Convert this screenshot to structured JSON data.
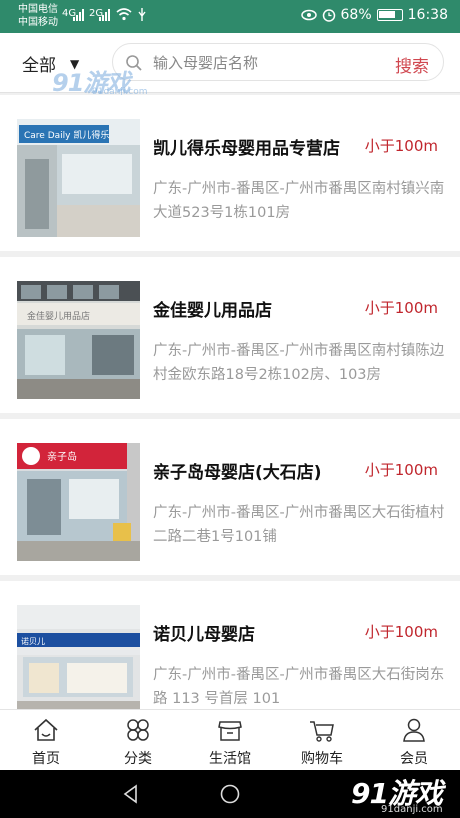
{
  "status_bar": {
    "carrier_1": "中国电信",
    "carrier_2": "中国移动",
    "net_1": "4G",
    "net_2": "2G",
    "battery": "68%",
    "time": "16:38"
  },
  "header": {
    "filter_label": "全部",
    "search_placeholder": "输入母婴店名称",
    "search_button": "搜索"
  },
  "watermark": {
    "logo": "91游戏",
    "url": "91danji.com"
  },
  "stores": [
    {
      "name": "凯儿得乐母婴用品专营店",
      "distance": "小于100m",
      "address": "广东-广州市-番禺区-广州市番禺区南村镇兴南大道523号1栋101房",
      "sign_text": "Care Daily  凯儿得乐"
    },
    {
      "name": "金佳婴儿用品店",
      "distance": "小于100m",
      "address": "广东-广州市-番禺区-广州市番禺区南村镇陈边村金欧东路18号2栋102房、103房",
      "sign_text": "金佳婴儿用品店"
    },
    {
      "name": "亲子岛母婴店(大石店)",
      "distance": "小于100m",
      "address": "广东-广州市-番禺区-广州市番禺区大石街植村二路二巷1号101铺",
      "sign_text": "亲子岛"
    },
    {
      "name": "诺贝儿母婴店",
      "distance": "小于100m",
      "address": "广东-广州市-番禺区-广州市番禺区大石街岗东路 113 号首层 101",
      "sign_text": "诺贝儿"
    }
  ],
  "tabs": [
    {
      "label": "首页",
      "icon": "home-icon"
    },
    {
      "label": "分类",
      "icon": "category-icon"
    },
    {
      "label": "生活馆",
      "icon": "shop-icon"
    },
    {
      "label": "购物车",
      "icon": "cart-icon"
    },
    {
      "label": "会员",
      "icon": "member-icon"
    }
  ],
  "colors": {
    "status_bar": "#2f8a6b",
    "accent_red": "#c0262d",
    "search_red": "#d0474f",
    "address_gray": "#9a9a9a"
  }
}
